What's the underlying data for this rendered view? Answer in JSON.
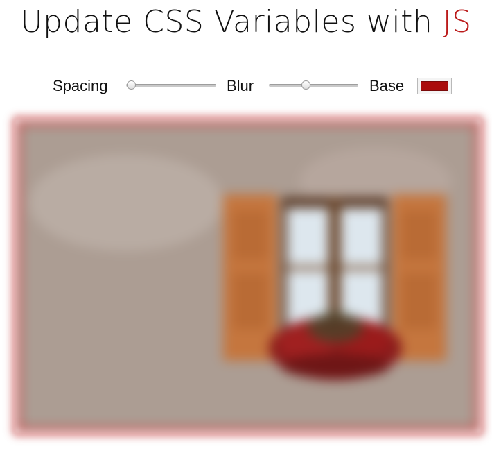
{
  "header": {
    "title_prefix": "Update CSS Variables with ",
    "title_highlight": "JS"
  },
  "controls": {
    "spacing": {
      "label": "Spacing",
      "value": 0.06
    },
    "blur": {
      "label": "Blur",
      "value": 0.42
    },
    "base": {
      "label": "Base",
      "value": "#aa0c0c"
    }
  },
  "colors": {
    "accent": "#bb1b1b",
    "frame_tint": "#c54242",
    "wall": "#b3a59c",
    "shutter": "#c5763e",
    "window_glass": "#dde7ee",
    "flowers": "#8a1c1c"
  },
  "image": {
    "subject": "blurred photo of a window with wooden shutters and red flower box"
  }
}
